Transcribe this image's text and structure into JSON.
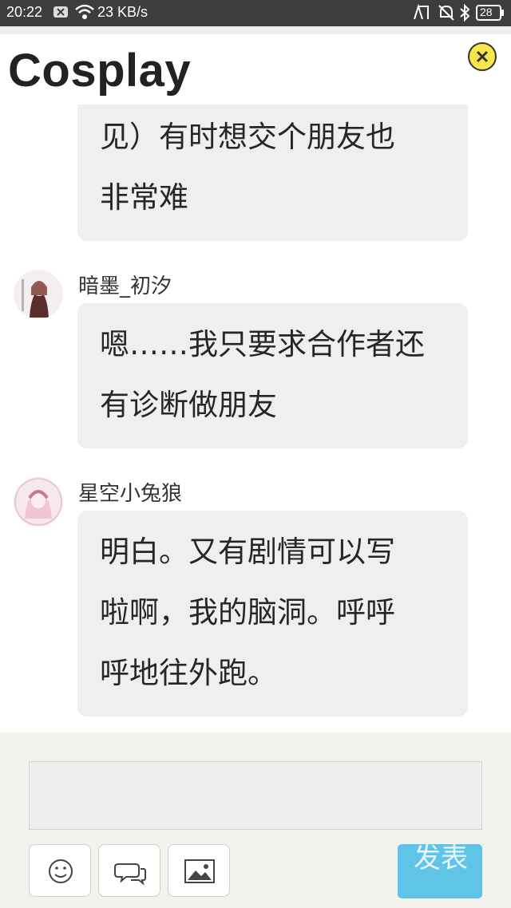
{
  "status_bar": {
    "time": "20:22",
    "net_speed": "23 KB/s",
    "battery": "28"
  },
  "header": {
    "title": "Cosplay"
  },
  "messages": [
    {
      "user": "",
      "lines": [
        "见）有时想交个朋友也",
        "非常难"
      ]
    },
    {
      "user": "暗墨_初汐",
      "lines": [
        "嗯……我只要求合作者还",
        "有诊断做朋友"
      ]
    },
    {
      "user": "星空小兔狼",
      "lines": [
        "明白。又有剧情可以写",
        "啦啊，我的脑洞。呼呼",
        "呼地往外跑。"
      ]
    }
  ],
  "composer": {
    "input_value": "",
    "send_label": "发表"
  },
  "colors": {
    "bubble": "#efefef",
    "send_button": "#5ec4e8",
    "close_button": "#f7e54a",
    "footer": "#f3f2ec"
  }
}
